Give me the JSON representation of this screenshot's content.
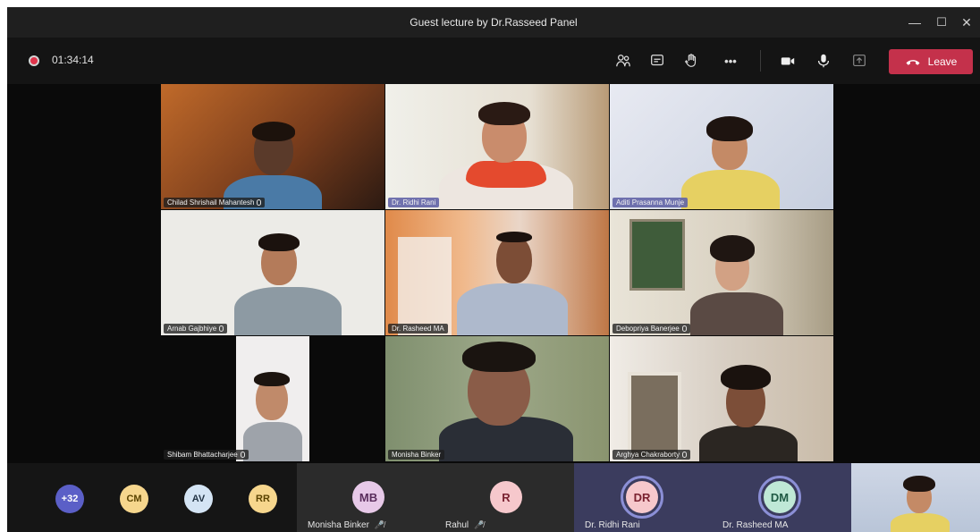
{
  "window": {
    "title": "Guest lecture by Dr.Rasseed Panel",
    "minimize": "—",
    "maximize": "☐",
    "close": "✕"
  },
  "meeting": {
    "timer": "01:34:14",
    "leave_label": "Leave",
    "more_label": "•••"
  },
  "colors": {
    "leave": "#c4314b",
    "active_speaker": "#6264a7",
    "recording": "#e0344b"
  },
  "icons": [
    "participants-icon",
    "chat-icon",
    "raise-hand-icon",
    "more-icon",
    "camera-icon",
    "mic-icon",
    "share-tray-icon",
    "phone-hangup-icon"
  ],
  "tiles": [
    {
      "name": "Chilad Shrishail Mahantesh",
      "mic": true,
      "active": false
    },
    {
      "name": "Dr. Ridhi Rani",
      "mic": false,
      "active": true
    },
    {
      "name": "Aditi Prasanna Munje",
      "mic": false,
      "active": true
    },
    {
      "name": "Arnab Gajbhiye",
      "mic": true,
      "active": false
    },
    {
      "name": "Dr. Rasheed MA",
      "mic": false,
      "active": false
    },
    {
      "name": "Debopriya Banerjee",
      "mic": true,
      "active": false
    },
    {
      "name": "Shibam Bhattacharjee",
      "mic": true,
      "active": false
    },
    {
      "name": "Monisha Binker",
      "mic": false,
      "active": false
    },
    {
      "name": "Arghya Chakraborty",
      "mic": true,
      "active": false
    }
  ],
  "roster": {
    "overflow": "+32",
    "avatars": [
      {
        "initials": "CM",
        "color": "#f6d68d"
      },
      {
        "initials": "AV",
        "color": "#d4e4f4"
      },
      {
        "initials": "RR",
        "color": "#f6d68d"
      }
    ],
    "participants": [
      {
        "initials": "MB",
        "name": "Monisha Binker",
        "muted": "🎤̸",
        "color": "#e7c9e8"
      },
      {
        "initials": "R",
        "name": "Rahul",
        "muted": "🎤̸",
        "color": "#f6c8cc"
      },
      {
        "initials": "DR",
        "name": "Dr. Ridhi Rani",
        "color": "#f6c8cc"
      },
      {
        "initials": "DM",
        "name": "Dr. Rasheed MA",
        "color": "#bfe8d6"
      }
    ]
  }
}
